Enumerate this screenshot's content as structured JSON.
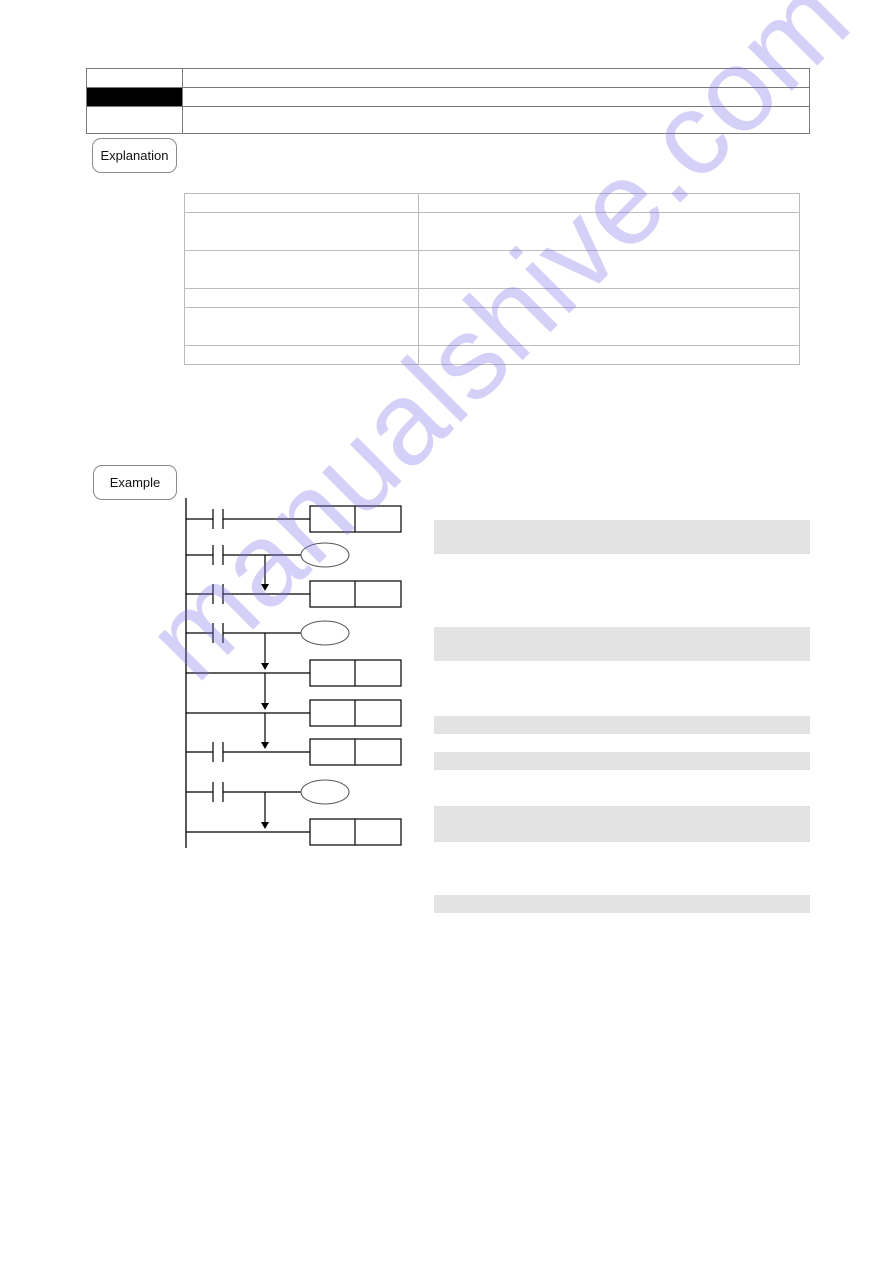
{
  "header_table": {
    "rows": [
      {
        "label": "",
        "value": "",
        "label_style": "plain"
      },
      {
        "label": "",
        "value": "",
        "label_style": "black"
      },
      {
        "label": "",
        "value": ""
      }
    ]
  },
  "explanation": {
    "label": "Explanation",
    "parameter_table": {
      "rows": [
        {
          "name": "",
          "description": ""
        },
        {
          "name": "",
          "description": ""
        },
        {
          "name": "",
          "description": ""
        },
        {
          "name": "",
          "description": ""
        },
        {
          "name": "",
          "description": ""
        },
        {
          "name": "",
          "description": ""
        }
      ]
    }
  },
  "example": {
    "label": "Example",
    "ladder_diagram": {
      "rungs": [
        {
          "input": "contact",
          "output": "instruction-box",
          "flow_arrow_above": false
        },
        {
          "input": "contact",
          "output": "coil",
          "flow_arrow_above": false
        },
        {
          "input": "contact",
          "output": "instruction-box",
          "flow_arrow_above": true
        },
        {
          "input": "contact",
          "output": "coil",
          "flow_arrow_above": false
        },
        {
          "input": "none",
          "output": "instruction-box",
          "flow_arrow_above": true
        },
        {
          "input": "none",
          "output": "instruction-box",
          "flow_arrow_above": true
        },
        {
          "input": "contact",
          "output": "instruction-box",
          "flow_arrow_above": true
        },
        {
          "input": "contact",
          "output": "coil",
          "flow_arrow_above": false
        },
        {
          "input": "none",
          "output": "instruction-box",
          "flow_arrow_above": true
        }
      ]
    },
    "notes": [
      "",
      "",
      "",
      "",
      "",
      ""
    ]
  },
  "watermark": {
    "text": "manualshive.com",
    "color": "#8c82e6"
  }
}
